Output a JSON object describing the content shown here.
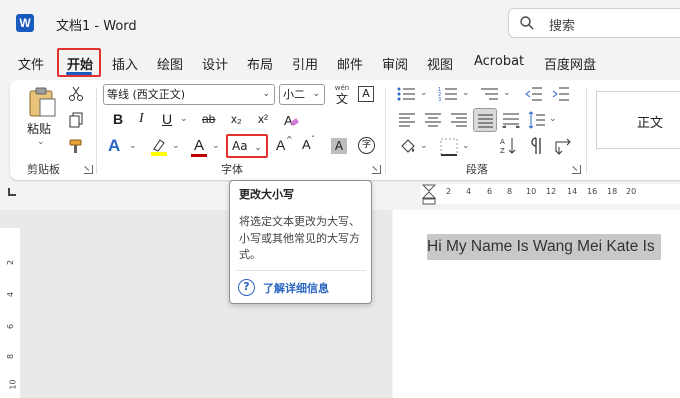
{
  "app": {
    "title": "文档1 - Word",
    "logo_letter": "W"
  },
  "search": {
    "placeholder": "搜索"
  },
  "tabs": [
    "文件",
    "开始",
    "插入",
    "绘图",
    "设计",
    "布局",
    "引用",
    "邮件",
    "审阅",
    "视图",
    "Acrobat",
    "百度网盘"
  ],
  "active_tab": "开始",
  "ribbon": {
    "clipboard": {
      "paste_label": "粘贴",
      "group_label": "剪贴板"
    },
    "font": {
      "font_name": "等线 (西文正文)",
      "font_size": "小二",
      "wen_label": "wén",
      "wen_char": "文",
      "bold": "B",
      "italic": "I",
      "underline": "U",
      "strike": "ab",
      "subscript": "x₂",
      "superscript": "x²",
      "text_effects": "A",
      "font_color": "A",
      "change_case": "Aa",
      "grow": "A",
      "shrink": "A",
      "char_shading": "A",
      "enclose_char": "字",
      "group_label": "字体"
    },
    "paragraph": {
      "group_label": "段落"
    },
    "styles": {
      "normal": "正文"
    }
  },
  "ruler": {
    "ticks": [
      "2",
      "2",
      "4",
      "6",
      "8",
      "10",
      "12",
      "14",
      "16",
      "18",
      "20"
    ]
  },
  "vruler": {
    "ticks": [
      "2",
      "4",
      "6",
      "8",
      "10"
    ]
  },
  "document": {
    "text": "Hi My Name Is Wang Mei Kate Is"
  },
  "tooltip": {
    "title": "更改大小写",
    "description": "将选定文本更改为大写、小写或其他常见的大写方式。",
    "link": "了解详细信息",
    "help_icon": "?"
  },
  "colors": {
    "accent": "#185abd",
    "highlight_red": "#e0312c",
    "link": "#2b66c3",
    "font_color_bar": "#c00000",
    "highlight_yellow": "#ffff00"
  }
}
